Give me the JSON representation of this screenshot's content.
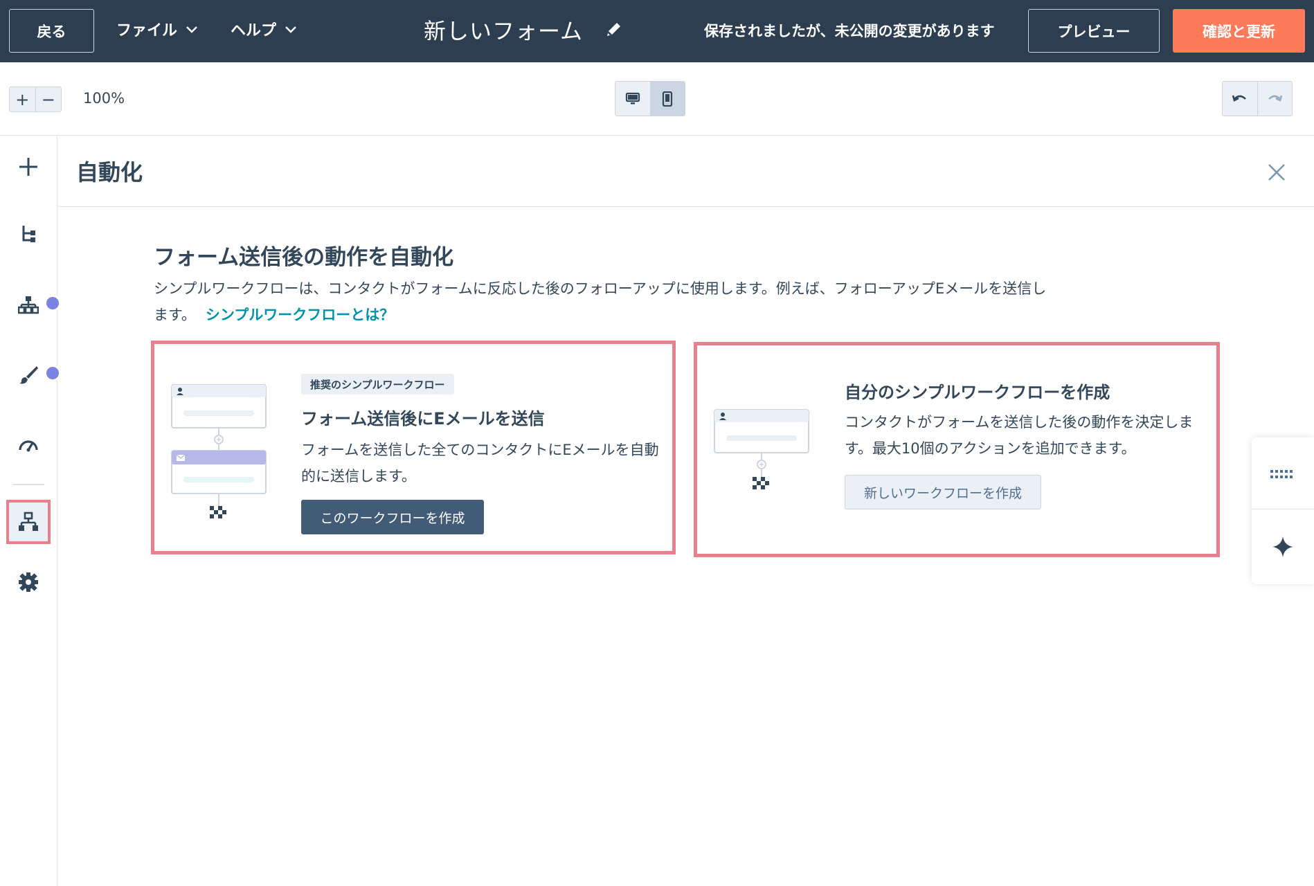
{
  "topbar": {
    "back_label": "戻る",
    "file_menu": "ファイル",
    "help_menu": "ヘルプ",
    "form_title": "新しいフォーム",
    "save_status": "保存されましたが、未公開の変更があります",
    "preview_label": "プレビュー",
    "update_label": "確認と更新"
  },
  "toolbar": {
    "zoom_in": "+",
    "zoom_out": "−",
    "zoom_level": "100%",
    "active_device": "mobile"
  },
  "rail": {
    "items": [
      {
        "icon": "plus-icon"
      },
      {
        "icon": "branch-icon"
      },
      {
        "icon": "hierarchy-icon",
        "indicator": true
      },
      {
        "icon": "brush-icon",
        "indicator": true
      },
      {
        "icon": "gauge-icon"
      },
      {
        "icon": "workflow-icon",
        "selected": true
      },
      {
        "icon": "gear-icon"
      }
    ]
  },
  "panel": {
    "title": "自動化",
    "heading": "フォーム送信後の動作を自動化",
    "description": "シンプルワークフローは、コンタクトがフォームに反応した後のフォローアップに使用します。例えば、フォローアップEメールを送信します。",
    "link": "シンプルワークフローとは？"
  },
  "cards": [
    {
      "badge": "推奨のシンプルワークフロー",
      "title": "フォーム送信後にEメールを送信",
      "description": "フォームを送信した全てのコンタクトにEメールを自動的に送信します。",
      "button": "このワークフローを作成"
    },
    {
      "title": "自分のシンプルワークフローを作成",
      "description": "コンタクトがフォームを送信した後の動作を決定します。最大10個のアクションを追加できます。",
      "button": "新しいワークフローを作成"
    }
  ],
  "colors": {
    "topbar": "#2d3e50",
    "accent": "#ff7a59",
    "highlight": "#e8818d",
    "link": "#0091ae",
    "indicator": "#7c82e0"
  }
}
